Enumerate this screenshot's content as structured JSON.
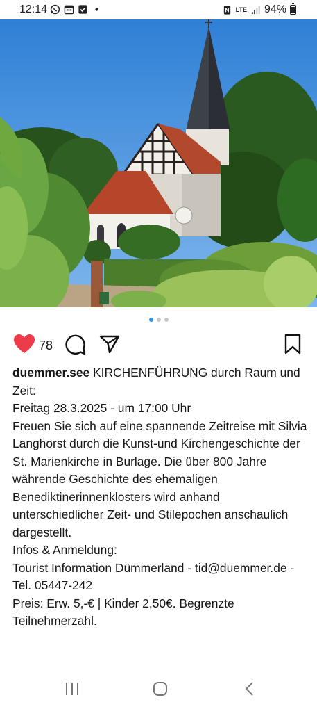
{
  "status_bar": {
    "time": "12:14",
    "network": "LTE",
    "battery": "94%"
  },
  "post": {
    "likes": "78",
    "carousel": {
      "count": 3,
      "active": 1
    },
    "username": "duemmer.see",
    "caption_title": "KIRCHENFÜHRUNG durch Raum und Zeit:",
    "caption_lines": [
      "Freitag 28.3.2025 - um 17:00 Uhr",
      "Freuen Sie sich auf eine spannende Zeitreise mit Silvia Langhorst durch die Kunst-und Kirchengeschichte der St. Marienkirche in Burlage. Die über 800 Jahre währende Geschichte des ehemaligen Benediktinerinnenklosters wird anhand unterschiedlicher Zeit- und Stilepochen anschaulich dargestellt.",
      "Infos & Anmeldung:",
      "Tourist Information Dümmerland - tid@duemmer.de - Tel. 05447-242",
      "Preis: Erw. 5,-€ | Kinder 2,50€. Begrenzte Teilnehmerzahl."
    ]
  },
  "colors": {
    "like_red": "#ed3b4a",
    "dot_active": "#2d8ff0",
    "sky": "#3f8fe0"
  },
  "icons": {
    "like": "heart-icon",
    "comment": "comment-icon",
    "share": "share-icon",
    "save": "bookmark-icon"
  }
}
